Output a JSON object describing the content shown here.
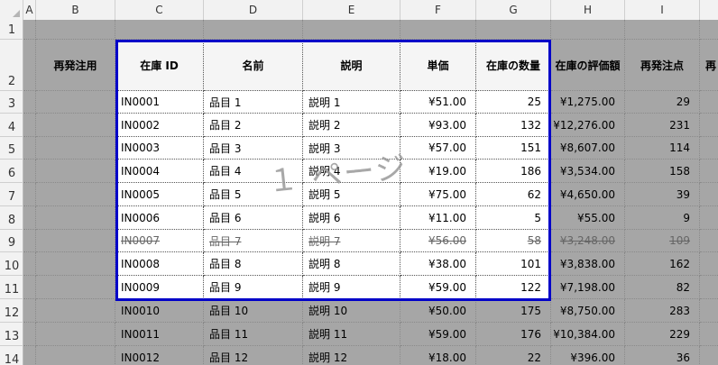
{
  "columns": [
    "A",
    "B",
    "C",
    "D",
    "E",
    "F",
    "G",
    "H",
    "I"
  ],
  "rows": [
    "1",
    "2",
    "3",
    "4",
    "5",
    "6",
    "7",
    "8",
    "9",
    "10",
    "11",
    "12",
    "13",
    "14"
  ],
  "header_row": {
    "reorder": "再発注用",
    "id": "在庫 ID",
    "name": "名前",
    "desc": "説明",
    "price": "単価",
    "qty": "在庫の数量",
    "value": "在庫の評価額",
    "reorder_point": "再発注点",
    "cut": "再"
  },
  "watermark": "１ ページ",
  "items": [
    {
      "id": "IN0001",
      "name": "品目 1",
      "desc": "説明 1",
      "price": "¥51.00",
      "qty": "25",
      "value": "¥1,275.00",
      "reorder": "29",
      "strike": false
    },
    {
      "id": "IN0002",
      "name": "品目 2",
      "desc": "説明 2",
      "price": "¥93.00",
      "qty": "132",
      "value": "¥12,276.00",
      "reorder": "231",
      "strike": false
    },
    {
      "id": "IN0003",
      "name": "品目 3",
      "desc": "説明 3",
      "price": "¥57.00",
      "qty": "151",
      "value": "¥8,607.00",
      "reorder": "114",
      "strike": false
    },
    {
      "id": "IN0004",
      "name": "品目 4",
      "desc": "説明 4",
      "price": "¥19.00",
      "qty": "186",
      "value": "¥3,534.00",
      "reorder": "158",
      "strike": false
    },
    {
      "id": "IN0005",
      "name": "品目 5",
      "desc": "説明 5",
      "price": "¥75.00",
      "qty": "62",
      "value": "¥4,650.00",
      "reorder": "39",
      "strike": false
    },
    {
      "id": "IN0006",
      "name": "品目 6",
      "desc": "説明 6",
      "price": "¥11.00",
      "qty": "5",
      "value": "¥55.00",
      "reorder": "9",
      "strike": false
    },
    {
      "id": "IN0007",
      "name": "品目 7",
      "desc": "説明 7",
      "price": "¥56.00",
      "qty": "58",
      "value": "¥3,248.00",
      "reorder": "109",
      "strike": true
    },
    {
      "id": "IN0008",
      "name": "品目 8",
      "desc": "説明 8",
      "price": "¥38.00",
      "qty": "101",
      "value": "¥3,838.00",
      "reorder": "162",
      "strike": false
    },
    {
      "id": "IN0009",
      "name": "品目 9",
      "desc": "説明 9",
      "price": "¥59.00",
      "qty": "122",
      "value": "¥7,198.00",
      "reorder": "82",
      "strike": false
    },
    {
      "id": "IN0010",
      "name": "品目 10",
      "desc": "説明 10",
      "price": "¥50.00",
      "qty": "175",
      "value": "¥8,750.00",
      "reorder": "283",
      "strike": false
    },
    {
      "id": "IN0011",
      "name": "品目 11",
      "desc": "説明 11",
      "price": "¥59.00",
      "qty": "176",
      "value": "¥10,384.00",
      "reorder": "229",
      "strike": false
    },
    {
      "id": "IN0012",
      "name": "品目 12",
      "desc": "説明 12",
      "price": "¥18.00",
      "qty": "22",
      "value": "¥396.00",
      "reorder": "36",
      "strike": false
    }
  ]
}
